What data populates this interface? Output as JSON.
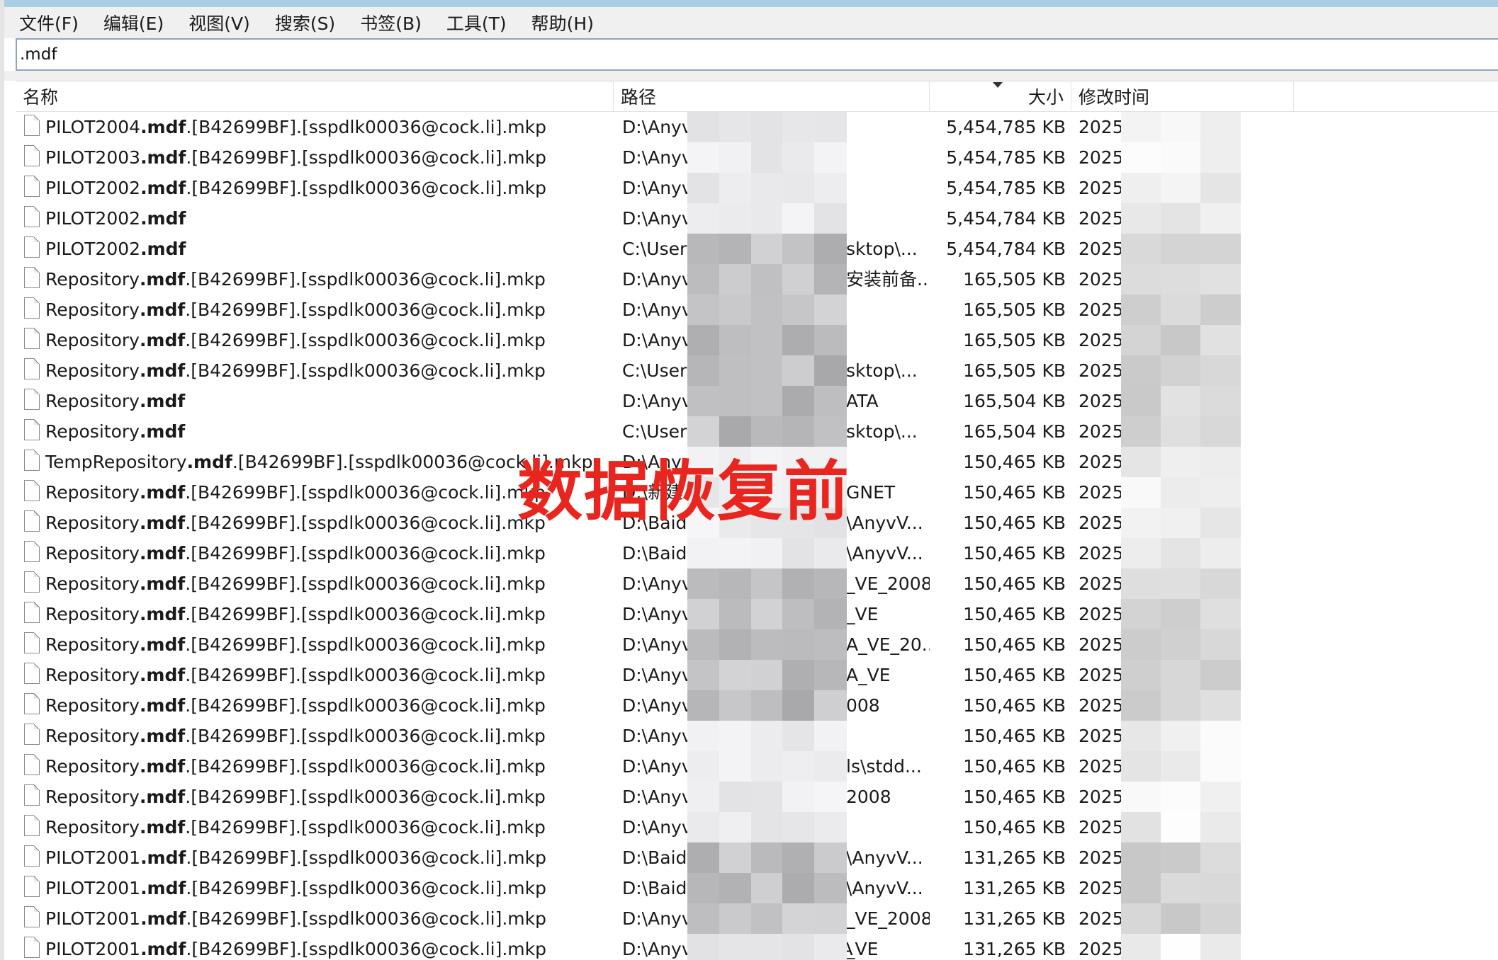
{
  "menu": [
    "文件(F)",
    "编辑(E)",
    "视图(V)",
    "搜索(S)",
    "书签(B)",
    "工具(T)",
    "帮助(H)"
  ],
  "search": {
    "value": ".mdf"
  },
  "columns": {
    "name": "名称",
    "path": "路径",
    "size": "大小",
    "modified": "修改时间"
  },
  "overlay_text": "数据恢复前",
  "rows": [
    {
      "pre": "PILOT2004",
      "mid": ".mdf",
      "post": ".[B42699BF].[sspdlk00036@cock.li].mkp",
      "path_start": "D:\\Anyv",
      "path_end": "",
      "size": "5,454,785 KB",
      "date": "2025/"
    },
    {
      "pre": "PILOT2003",
      "mid": ".mdf",
      "post": ".[B42699BF].[sspdlk00036@cock.li].mkp",
      "path_start": "D:\\Anyv",
      "path_end": "",
      "size": "5,454,785 KB",
      "date": "2025/"
    },
    {
      "pre": "PILOT2002",
      "mid": ".mdf",
      "post": ".[B42699BF].[sspdlk00036@cock.li].mkp",
      "path_start": "D:\\Anyv",
      "path_end": "",
      "size": "5,454,785 KB",
      "date": "2025/"
    },
    {
      "pre": "PILOT2002",
      "mid": ".mdf",
      "post": "",
      "path_start": "D:\\Anyv",
      "path_end": "",
      "size": "5,454,784 KB",
      "date": "2025/"
    },
    {
      "pre": "PILOT2002",
      "mid": ".mdf",
      "post": "",
      "path_start": "C:\\User",
      "path_end": "sktop\\...",
      "size": "5,454,784 KB",
      "date": "2025/"
    },
    {
      "pre": "Repository",
      "mid": ".mdf",
      "post": ".[B42699BF].[sspdlk00036@cock.li].mkp",
      "path_start": "D:\\Anyv",
      "path_end": "安装前备...",
      "size": "165,505 KB",
      "date": "2025/"
    },
    {
      "pre": "Repository",
      "mid": ".mdf",
      "post": ".[B42699BF].[sspdlk00036@cock.li].mkp",
      "path_start": "D:\\Anyv",
      "path_end": "",
      "size": "165,505 KB",
      "date": "2025/"
    },
    {
      "pre": "Repository",
      "mid": ".mdf",
      "post": ".[B42699BF].[sspdlk00036@cock.li].mkp",
      "path_start": "D:\\Anyv",
      "path_end": "",
      "size": "165,505 KB",
      "date": "2025/"
    },
    {
      "pre": "Repository",
      "mid": ".mdf",
      "post": ".[B42699BF].[sspdlk00036@cock.li].mkp",
      "path_start": "C:\\User",
      "path_end": "sktop\\...",
      "size": "165,505 KB",
      "date": "2025/"
    },
    {
      "pre": "Repository",
      "mid": ".mdf",
      "post": "",
      "path_start": "D:\\Anyv",
      "path_end": "ATA",
      "size": "165,504 KB",
      "date": "2025/"
    },
    {
      "pre": "Repository",
      "mid": ".mdf",
      "post": "",
      "path_start": "C:\\User",
      "path_end": "sktop\\...",
      "size": "165,504 KB",
      "date": "2025/"
    },
    {
      "pre": "TempRepository",
      "mid": ".mdf",
      "post": ".[B42699BF].[sspdlk00036@cock.li].mkp",
      "path_start": "D:\\Anyv",
      "path_end": "",
      "size": "150,465 KB",
      "date": "2025/"
    },
    {
      "pre": "Repository",
      "mid": ".mdf",
      "post": ".[B42699BF].[sspdlk00036@cock.li].mkp",
      "path_start": "D:\\新建",
      "path_end": "GNET",
      "size": "150,465 KB",
      "date": "2025/"
    },
    {
      "pre": "Repository",
      "mid": ".mdf",
      "post": ".[B42699BF].[sspdlk00036@cock.li].mkp",
      "path_start": "D:\\Baid",
      "path_end": "\\AnyvV...",
      "size": "150,465 KB",
      "date": "2025/"
    },
    {
      "pre": "Repository",
      "mid": ".mdf",
      "post": ".[B42699BF].[sspdlk00036@cock.li].mkp",
      "path_start": "D:\\Baid",
      "path_end": "\\AnyvV...",
      "size": "150,465 KB",
      "date": "2025/"
    },
    {
      "pre": "Repository",
      "mid": ".mdf",
      "post": ".[B42699BF].[sspdlk00036@cock.li].mkp",
      "path_start": "D:\\Anyv",
      "path_end": "_VE_2008",
      "size": "150,465 KB",
      "date": "2025/"
    },
    {
      "pre": "Repository",
      "mid": ".mdf",
      "post": ".[B42699BF].[sspdlk00036@cock.li].mkp",
      "path_start": "D:\\Anyv",
      "path_end": "_VE",
      "size": "150,465 KB",
      "date": "2025/"
    },
    {
      "pre": "Repository",
      "mid": ".mdf",
      "post": ".[B42699BF].[sspdlk00036@cock.li].mkp",
      "path_start": "D:\\Anyv",
      "path_end": "A_VE_20...",
      "size": "150,465 KB",
      "date": "2025/"
    },
    {
      "pre": "Repository",
      "mid": ".mdf",
      "post": ".[B42699BF].[sspdlk00036@cock.li].mkp",
      "path_start": "D:\\Anyv",
      "path_end": "A_VE",
      "size": "150,465 KB",
      "date": "2025/"
    },
    {
      "pre": "Repository",
      "mid": ".mdf",
      "post": ".[B42699BF].[sspdlk00036@cock.li].mkp",
      "path_start": "D:\\Anyv",
      "path_end": "008",
      "size": "150,465 KB",
      "date": "2025/"
    },
    {
      "pre": "Repository",
      "mid": ".mdf",
      "post": ".[B42699BF].[sspdlk00036@cock.li].mkp",
      "path_start": "D:\\Anyv",
      "path_end": "",
      "size": "150,465 KB",
      "date": "2025/"
    },
    {
      "pre": "Repository",
      "mid": ".mdf",
      "post": ".[B42699BF].[sspdlk00036@cock.li].mkp",
      "path_start": "D:\\Anyv",
      "path_end": "ls\\stdd...",
      "size": "150,465 KB",
      "date": "2025/"
    },
    {
      "pre": "Repository",
      "mid": ".mdf",
      "post": ".[B42699BF].[sspdlk00036@cock.li].mkp",
      "path_start": "D:\\Anyv",
      "path_end": "2008",
      "size": "150,465 KB",
      "date": "2025/"
    },
    {
      "pre": "Repository",
      "mid": ".mdf",
      "post": ".[B42699BF].[sspdlk00036@cock.li].mkp",
      "path_start": "D:\\Anyv",
      "path_end": "",
      "size": "150,465 KB",
      "date": "2025/"
    },
    {
      "pre": "PILOT2001",
      "mid": ".mdf",
      "post": ".[B42699BF].[sspdlk00036@cock.li].mkp",
      "path_start": "D:\\Baid",
      "path_end": "\\AnyvV...",
      "size": "131,265 KB",
      "date": "2025/"
    },
    {
      "pre": "PILOT2001",
      "mid": ".mdf",
      "post": ".[B42699BF].[sspdlk00036@cock.li].mkp",
      "path_start": "D:\\Baid",
      "path_end": "\\AnyvV...",
      "size": "131,265 KB",
      "date": "2025/"
    },
    {
      "pre": "PILOT2001",
      "mid": ".mdf",
      "post": ".[B42699BF].[sspdlk00036@cock.li].mkp",
      "path_start": "D:\\Anyv",
      "path_end": "_VE_2008",
      "size": "131,265 KB",
      "date": "2025/"
    },
    {
      "pre": "PILOT2001",
      "mid": ".mdf",
      "post": ".[B42699BF].[sspdlk00036@cock.li].mkp",
      "path_start": "D:\\AnyvVEPROGNET\\DATA",
      "path_end": "_VE",
      "size": "131,265 KB",
      "date": "2025/"
    }
  ]
}
